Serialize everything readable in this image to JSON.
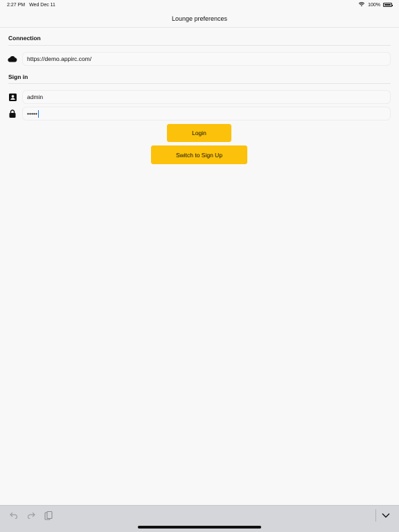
{
  "status": {
    "time": "2:27 PM",
    "date": "Wed Dec 11",
    "battery": "100%",
    "battery_level": 1.0
  },
  "nav": {
    "title": "Lounge preferences"
  },
  "connection": {
    "header": "Connection",
    "server_url": "https://demo.appirc.com/",
    "icon": "cloud-icon"
  },
  "signin": {
    "header": "Sign in",
    "username": "admin",
    "username_icon": "person-icon",
    "password_masked": "•••••",
    "password_icon": "lock-icon"
  },
  "buttons": {
    "login": "Login",
    "switch_signup": "Switch to Sign Up"
  },
  "colors": {
    "accent": "#fcc10a",
    "background": "#f8f8f8",
    "keyboard_bar": "#d4d6da"
  },
  "keyboard_toolbar": {
    "icons": [
      "undo-icon",
      "redo-icon",
      "paste-icon",
      "chevron-down-icon"
    ]
  }
}
